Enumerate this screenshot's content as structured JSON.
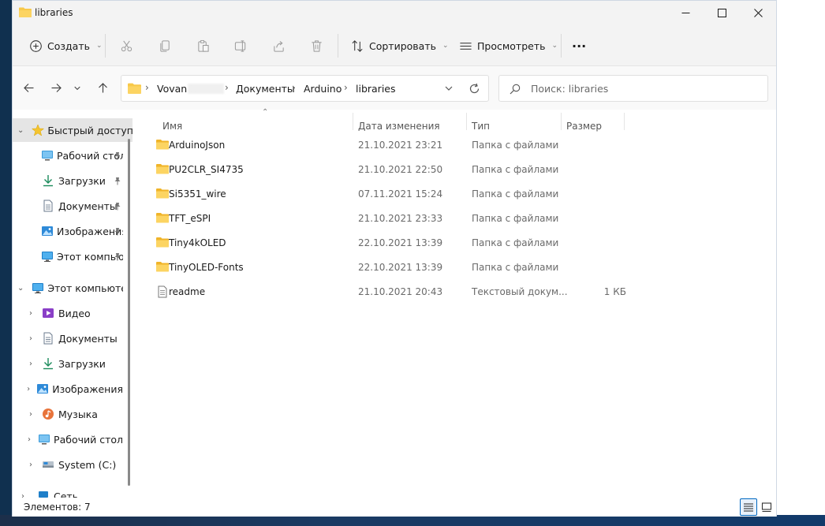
{
  "window": {
    "title": "libraries"
  },
  "toolbar": {
    "create_label": "Создать",
    "sort_label": "Сортировать",
    "view_label": "Просмотреть",
    "more_label": "···"
  },
  "address": {
    "crumbs": [
      "Vovan N",
      "Документы",
      "Arduino",
      "libraries"
    ]
  },
  "search": {
    "placeholder": "Поиск: libraries"
  },
  "sidebar": {
    "items": [
      {
        "label": "Быстрый доступ",
        "icon": "star-icon"
      },
      {
        "label": "Рабочий стол",
        "icon": "desktop-icon"
      },
      {
        "label": "Загрузки",
        "icon": "download-icon"
      },
      {
        "label": "Документы",
        "icon": "document-icon"
      },
      {
        "label": "Изображения",
        "icon": "picture-icon"
      },
      {
        "label": "Этот компьютер",
        "icon": "monitor-icon"
      },
      {
        "label": "Этот компьютер",
        "icon": "monitor-icon"
      },
      {
        "label": "Видео",
        "icon": "video-icon"
      },
      {
        "label": "Документы",
        "icon": "document-icon"
      },
      {
        "label": "Загрузки",
        "icon": "download-icon"
      },
      {
        "label": "Изображения",
        "icon": "picture-icon"
      },
      {
        "label": "Музыка",
        "icon": "music-icon"
      },
      {
        "label": "Рабочий стол",
        "icon": "desktop-icon"
      },
      {
        "label": "System (C:)",
        "icon": "drive-icon"
      },
      {
        "label": "Сеть",
        "icon": "network-icon"
      }
    ]
  },
  "table": {
    "columns": [
      "Имя",
      "Дата изменения",
      "Тип",
      "Размер"
    ],
    "rows": [
      {
        "name": "ArduinoJson",
        "date": "21.10.2021 23:21",
        "type": "Папка с файлами",
        "size": "",
        "icon": "folder-icon"
      },
      {
        "name": "PU2CLR_SI4735",
        "date": "21.10.2021 22:50",
        "type": "Папка с файлами",
        "size": "",
        "icon": "folder-icon"
      },
      {
        "name": "Si5351_wire",
        "date": "07.11.2021 15:24",
        "type": "Папка с файлами",
        "size": "",
        "icon": "folder-icon"
      },
      {
        "name": "TFT_eSPI",
        "date": "21.10.2021 23:33",
        "type": "Папка с файлами",
        "size": "",
        "icon": "folder-icon"
      },
      {
        "name": "Tiny4kOLED",
        "date": "22.10.2021 13:39",
        "type": "Папка с файлами",
        "size": "",
        "icon": "folder-icon"
      },
      {
        "name": "TinyOLED-Fonts",
        "date": "22.10.2021 13:39",
        "type": "Папка с файлами",
        "size": "",
        "icon": "folder-icon"
      },
      {
        "name": "readme",
        "date": "21.10.2021 20:43",
        "type": "Текстовый докум...",
        "size": "1 КБ",
        "icon": "text-file-icon"
      }
    ]
  },
  "status": {
    "count_text": "Элементов: 7"
  },
  "colors": {
    "folder": "#f8c94a",
    "accent": "#0067c0"
  }
}
